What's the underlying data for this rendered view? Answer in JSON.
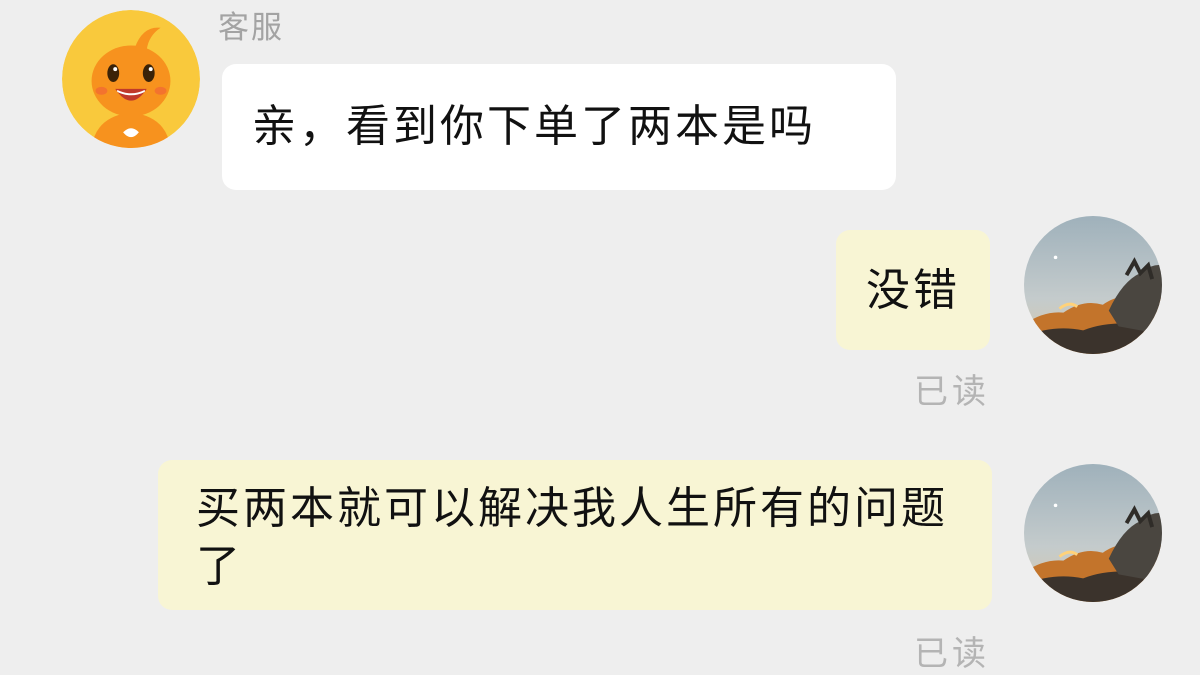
{
  "agent": {
    "name": "客服",
    "avatar_icon": "orange-mascot-avatar-icon"
  },
  "messages": [
    {
      "direction": "incoming",
      "text": "亲，看到你下单了两本是吗"
    },
    {
      "direction": "outgoing",
      "text": "没错",
      "status": "已读"
    },
    {
      "direction": "outgoing",
      "text": "买两本就可以解决我人生所有的问题了",
      "status": "已读"
    }
  ],
  "user": {
    "avatar_icon": "sunset-landscape-avatar-icon"
  },
  "colors": {
    "background": "#eeeeee",
    "incoming_bubble": "#ffffff",
    "outgoing_bubble": "#f8f5d4",
    "muted_text": "#a3a3a3",
    "accent_orange": "#f7921e",
    "avatar_ring": "#f9c93c"
  }
}
